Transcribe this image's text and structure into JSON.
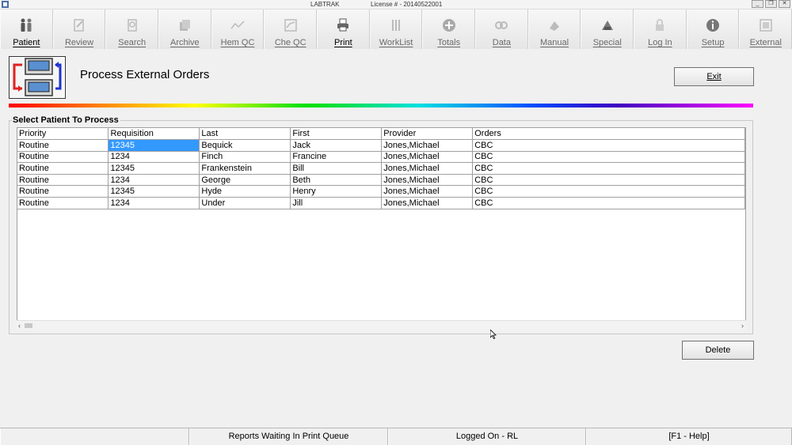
{
  "window": {
    "title": "LABTRAK",
    "license": "License # - 20140522001",
    "controls": [
      "minimize",
      "restore",
      "close"
    ]
  },
  "toolbar": [
    {
      "label": "Patient",
      "icon": "patient-icon",
      "enabled": true
    },
    {
      "label": "Review",
      "icon": "review-icon",
      "enabled": false
    },
    {
      "label": "Search",
      "icon": "search-icon",
      "enabled": false
    },
    {
      "label": "Archive",
      "icon": "archive-icon",
      "enabled": false
    },
    {
      "label": "Hem QC",
      "icon": "hem-qc-icon",
      "enabled": false
    },
    {
      "label": "Che QC",
      "icon": "che-qc-icon",
      "enabled": false
    },
    {
      "label": "Print",
      "icon": "print-icon",
      "enabled": true
    },
    {
      "label": "WorkList",
      "icon": "worklist-icon",
      "enabled": false
    },
    {
      "label": "Totals",
      "icon": "totals-icon",
      "enabled": false
    },
    {
      "label": "Data",
      "icon": "data-icon",
      "enabled": false
    },
    {
      "label": "Manual",
      "icon": "manual-icon",
      "enabled": false
    },
    {
      "label": "Special",
      "icon": "special-icon",
      "enabled": false
    },
    {
      "label": "Log In",
      "icon": "lock-icon",
      "enabled": false
    },
    {
      "label": "Setup",
      "icon": "info-icon",
      "enabled": false
    },
    {
      "label": "External",
      "icon": "external-icon",
      "enabled": false
    }
  ],
  "page": {
    "title": "Process External Orders",
    "exit_label": "Exit",
    "delete_label": "Delete",
    "group_label": "Select Patient To Process"
  },
  "table": {
    "columns": [
      "Priority",
      "Requisition",
      "Last",
      "First",
      "Provider",
      "Orders"
    ],
    "rows": [
      [
        "Routine",
        "12345",
        "Bequick",
        "Jack",
        "Jones,Michael",
        "CBC"
      ],
      [
        "Routine",
        "1234",
        "Finch",
        "Francine",
        "Jones,Michael",
        "CBC"
      ],
      [
        "Routine",
        "12345",
        "Frankenstein",
        "Bill",
        "Jones,Michael",
        "CBC"
      ],
      [
        "Routine",
        "1234",
        "George",
        "Beth",
        "Jones,Michael",
        "CBC"
      ],
      [
        "Routine",
        "12345",
        "Hyde",
        "Henry",
        "Jones,Michael",
        "CBC"
      ],
      [
        "Routine",
        "1234",
        "Under",
        "Jill",
        "Jones,Michael",
        "CBC"
      ]
    ],
    "selected_cell": {
      "row": 0,
      "column": 1
    }
  },
  "status_bar": {
    "print_queue": "Reports Waiting In Print Queue",
    "logged_on": "Logged On - RL",
    "help": "[F1 - Help]"
  },
  "colors": {
    "selection": "#3399ff",
    "background": "#f0f0f0"
  }
}
